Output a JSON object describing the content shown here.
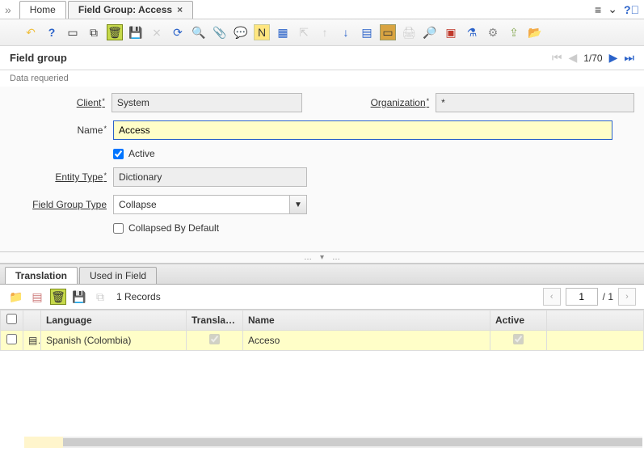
{
  "tabs": {
    "home": "Home",
    "active": "Field Group: Access"
  },
  "section": {
    "title": "Field group",
    "pager": "1/70"
  },
  "status": "Data requeried",
  "form": {
    "client_label": "Client",
    "client_value": "System",
    "org_label": "Organization",
    "org_value": "*",
    "name_label": "Name",
    "name_value": "Access",
    "active_label": "Active",
    "entity_label": "Entity Type",
    "entity_value": "Dictionary",
    "fgtype_label": "Field Group Type",
    "fgtype_value": "Collapse",
    "collapsed_label": "Collapsed By Default"
  },
  "subtabs": {
    "translation": "Translation",
    "used": "Used in Field"
  },
  "subtoolbar": {
    "records": "1 Records",
    "page": "1",
    "total": "/ 1"
  },
  "grid": {
    "headers": {
      "lang": "Language",
      "translated": "Translated",
      "name": "Name",
      "active": "Active"
    },
    "rows": [
      {
        "lang": "Spanish (Colombia)",
        "translated": true,
        "name": "Acceso",
        "active": true
      }
    ]
  }
}
